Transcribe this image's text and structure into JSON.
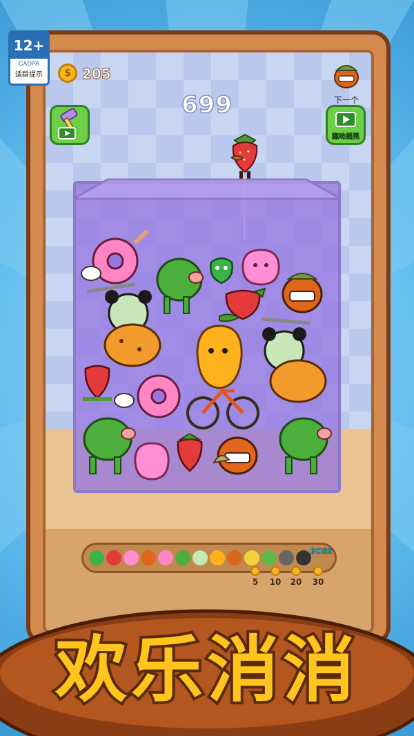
{
  "badge": {
    "age": "12+",
    "org": "CADPA",
    "tip": "适龄提示"
  },
  "hud": {
    "coins": "205",
    "score": "699",
    "next_label": "下一个",
    "shake_label": "趣味摇晃"
  },
  "tray": {
    "boss_label": "BOSS",
    "rewards": [
      "5",
      "10",
      "20",
      "30"
    ]
  },
  "title": {
    "text": "欢乐消消"
  },
  "colors": {
    "sky": "#5ab8ec",
    "frame": "#d58a4f",
    "box": "#9678e1",
    "title_fill": "#ffc51e",
    "title_stroke": "#5a2a0e"
  },
  "icons": [
    "coin-icon",
    "hammer-icon",
    "video-icon",
    "next-monster-icon",
    "strawberry-icon",
    "mango-icon",
    "panda-icon",
    "cactus-pig-icon",
    "donut-icon",
    "pepper-icon",
    "blob-icon",
    "pumpkin-monster-icon",
    "boss-icon"
  ]
}
